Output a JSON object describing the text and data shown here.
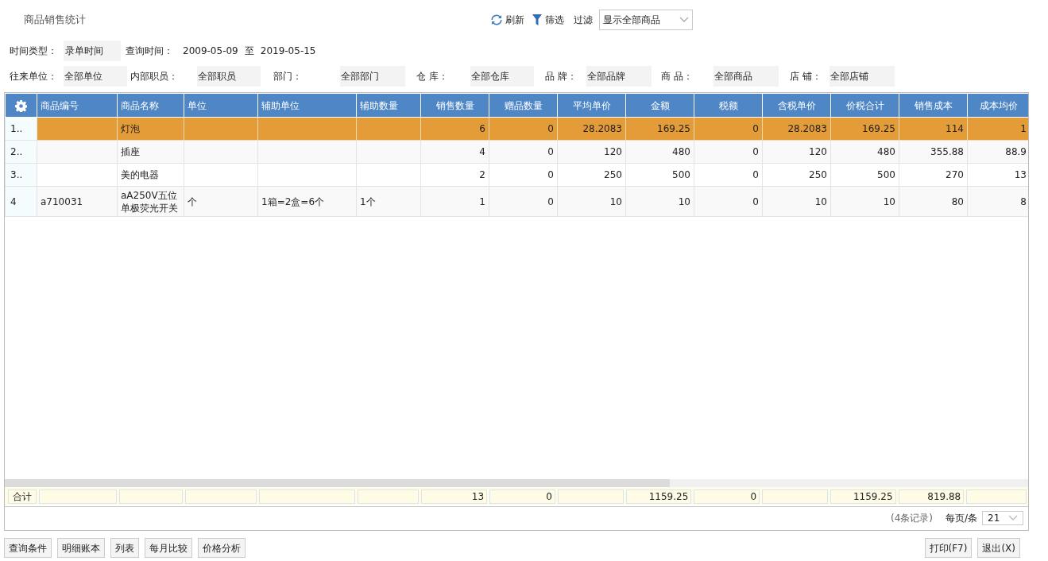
{
  "title": "商品销售统计",
  "toolbar": [
    {
      "kind": "refresh",
      "label": "刷新"
    },
    {
      "kind": "filter",
      "label": "筛选"
    }
  ],
  "filter_select": {
    "label": "过滤",
    "value": "显示全部商品"
  },
  "time_row": {
    "type_label": "时间类型：",
    "type_value": "录单时间",
    "query_label": "查询时间：",
    "from": "2009-05-09",
    "to_label": "至",
    "to": "2019-05-15"
  },
  "filters": [
    {
      "label": "往来单位：",
      "value": "全部单位"
    },
    {
      "label": "内部职员：",
      "value": "全部职员"
    },
    {
      "label": "部门：",
      "value": "全部部门"
    },
    {
      "label": "仓 库：",
      "value": "全部仓库"
    },
    {
      "label": "品 牌：",
      "value": "全部品牌"
    },
    {
      "label": "商 品：",
      "value": "全部商品"
    },
    {
      "label": "店 铺：",
      "value": "全部店铺"
    }
  ],
  "table": {
    "columns": [
      "商品编号",
      "商品名称",
      "单位",
      "辅助单位",
      "辅助数量",
      "销售数量",
      "赠品数量",
      "平均单价",
      "金额",
      "税额",
      "含税单价",
      "价税合计",
      "销售成本",
      "成本均价"
    ],
    "rows": [
      {
        "selected": true,
        "index": "1..",
        "cells": [
          null,
          "灯泡",
          null,
          null,
          null,
          "6",
          "0",
          "28.2083",
          "169.25",
          "0",
          "28.2083",
          "169.25",
          "114",
          "1"
        ]
      },
      {
        "selected": false,
        "index": "2..",
        "cells": [
          null,
          "插座",
          null,
          null,
          null,
          "4",
          "0",
          "120",
          "480",
          "0",
          "120",
          "480",
          "355.88",
          "88.9"
        ]
      },
      {
        "selected": false,
        "index": "3..",
        "cells": [
          null,
          "美的电器",
          null,
          null,
          null,
          "2",
          "0",
          "250",
          "500",
          "0",
          "250",
          "500",
          "270",
          "13"
        ]
      },
      {
        "selected": false,
        "index": "4",
        "cells": [
          "a710031",
          "aA250V五位单极荧光开关",
          "个",
          "1箱=2盒=6个",
          "1个",
          "1",
          "0",
          "10",
          "10",
          "0",
          "10",
          "10",
          "80",
          "8"
        ]
      }
    ],
    "totals_label": "合计",
    "totals": [
      {
        "kind": "empty"
      },
      {
        "kind": "empty"
      },
      {
        "kind": "empty"
      },
      {
        "kind": "empty"
      },
      {
        "kind": "empty"
      },
      {
        "kind": "value",
        "value": "13"
      },
      {
        "kind": "value",
        "value": "0"
      },
      {
        "kind": "empty"
      },
      {
        "kind": "value",
        "value": "1159.25"
      },
      {
        "kind": "value",
        "value": "0"
      },
      {
        "kind": "empty"
      },
      {
        "kind": "value",
        "value": "1159.25"
      },
      {
        "kind": "value",
        "value": "819.88"
      },
      {
        "kind": "empty"
      }
    ]
  },
  "pager": {
    "records": "(4条记录)",
    "per_page_label": "每页/条",
    "per_page": "21"
  },
  "left_buttons": [
    "查询条件",
    "明细账本",
    "列表",
    "每月比较",
    "价格分析"
  ],
  "right_buttons": [
    "打印(F7)",
    "退出(X)"
  ]
}
